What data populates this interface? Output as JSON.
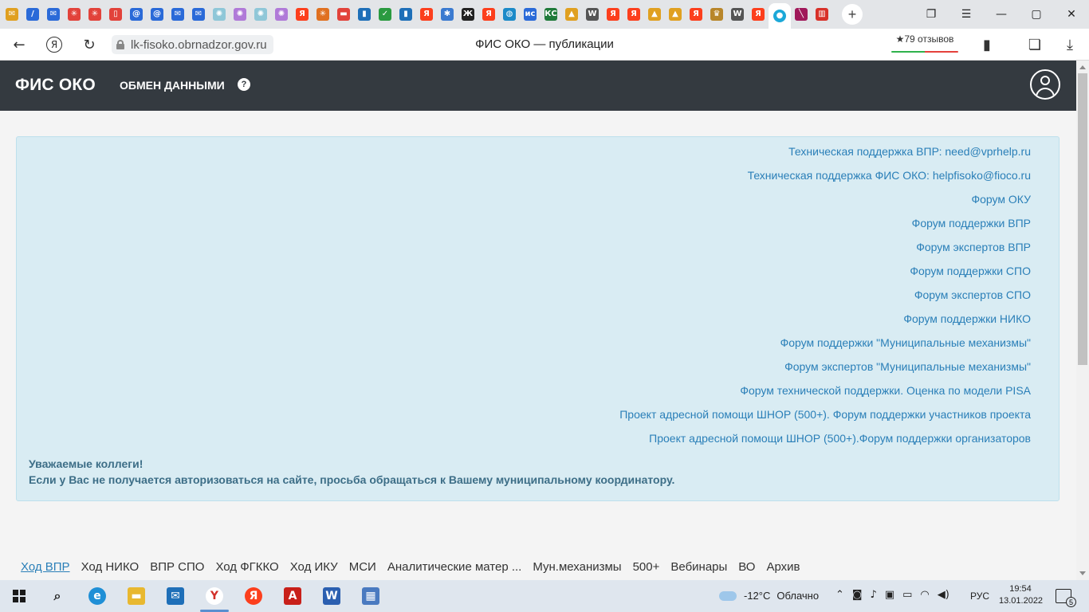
{
  "browser": {
    "tabs": [
      {
        "name": "tab-mail",
        "color": "#e0a020",
        "glyph": "✉"
      },
      {
        "name": "tab-edit",
        "color": "#2a6ad8",
        "glyph": "/"
      },
      {
        "name": "tab-mail2",
        "color": "#2a6ad8",
        "glyph": "✉"
      },
      {
        "name": "tab-wheel1",
        "color": "#e2423a",
        "glyph": "✳"
      },
      {
        "name": "tab-wheel2",
        "color": "#e2423a",
        "glyph": "✳"
      },
      {
        "name": "tab-pdf",
        "color": "#e2423a",
        "glyph": "▯"
      },
      {
        "name": "tab-at1",
        "color": "#2a6ad8",
        "glyph": "@"
      },
      {
        "name": "tab-at2",
        "color": "#2a6ad8",
        "glyph": "@"
      },
      {
        "name": "tab-mail3",
        "color": "#2a6ad8",
        "glyph": "✉"
      },
      {
        "name": "tab-mail4",
        "color": "#2a6ad8",
        "glyph": "✉"
      },
      {
        "name": "tab-dots1",
        "color": "#8fc7d8",
        "glyph": "✺"
      },
      {
        "name": "tab-dots2",
        "color": "#b07ad8",
        "glyph": "✺"
      },
      {
        "name": "tab-dots3",
        "color": "#8fc7d8",
        "glyph": "✺"
      },
      {
        "name": "tab-dots4",
        "color": "#b07ad8",
        "glyph": "✺"
      },
      {
        "name": "tab-yandex1",
        "color": "#fc3f1d",
        "glyph": "Я"
      },
      {
        "name": "tab-wheel3",
        "color": "#e07020",
        "glyph": "✳"
      },
      {
        "name": "tab-box",
        "color": "#e2423a",
        "glyph": "▬"
      },
      {
        "name": "tab-book1",
        "color": "#1e6fb8",
        "glyph": "▮"
      },
      {
        "name": "tab-check",
        "color": "#2a9a40",
        "glyph": "✓"
      },
      {
        "name": "tab-book2",
        "color": "#1e6fb8",
        "glyph": "▮"
      },
      {
        "name": "tab-yandex2",
        "color": "#fc3f1d",
        "glyph": "Я"
      },
      {
        "name": "tab-star",
        "color": "#3a7ad0",
        "glyph": "✱"
      },
      {
        "name": "tab-zh",
        "color": "#222222",
        "glyph": "Ж"
      },
      {
        "name": "tab-yandex3",
        "color": "#fc3f1d",
        "glyph": "Я"
      },
      {
        "name": "tab-globe",
        "color": "#1c8ac8",
        "glyph": "◍"
      },
      {
        "name": "tab-mos",
        "color": "#2a6ad8",
        "glyph": "ис"
      },
      {
        "name": "tab-kc",
        "color": "#1f7a3a",
        "glyph": "КС"
      },
      {
        "name": "tab-hat1",
        "color": "#e0a020",
        "glyph": "▲"
      },
      {
        "name": "tab-wiki1",
        "color": "#555555",
        "glyph": "W"
      },
      {
        "name": "tab-yandex4",
        "color": "#fc3f1d",
        "glyph": "Я"
      },
      {
        "name": "tab-yandex5",
        "color": "#fc3f1d",
        "glyph": "Я"
      },
      {
        "name": "tab-hat2",
        "color": "#e0a020",
        "glyph": "▲"
      },
      {
        "name": "tab-hat3",
        "color": "#e0a020",
        "glyph": "▲"
      },
      {
        "name": "tab-yandex6",
        "color": "#fc3f1d",
        "glyph": "Я"
      },
      {
        "name": "tab-emblem",
        "color": "#b8862a",
        "glyph": "♛"
      },
      {
        "name": "tab-wiki2",
        "color": "#555555",
        "glyph": "W"
      },
      {
        "name": "tab-yandex7",
        "color": "#fc3f1d",
        "glyph": "Я"
      },
      {
        "name": "tab-fisoko-active",
        "color": "#1ca8d8",
        "glyph": "●"
      },
      {
        "name": "tab-feather",
        "color": "#a0185a",
        "glyph": "╲"
      },
      {
        "name": "tab-bars",
        "color": "#d8322a",
        "glyph": "▥"
      }
    ],
    "url": "lk-fisoko.obrnadzor.gov.ru",
    "page_title": "ФИС ОКО — публикации",
    "reviews": "★79 отзывов"
  },
  "site": {
    "logo": "ФИС ОКО",
    "nav_exchange": "ОБМЕН ДАННЫМИ",
    "help_glyph": "?"
  },
  "links": [
    "Техническая поддержка ВПР: need@vprhelp.ru",
    "Техническая поддержка ФИС ОКО: helpfisoko@fioco.ru",
    "Форум ОКУ",
    "Форум поддержки ВПР",
    "Форум экспертов ВПР",
    "Форум поддержки СПО",
    "Форум экспертов СПО",
    "Форум поддержки НИКО",
    "Форум поддержки \"Муниципальные механизмы\"",
    "Форум экспертов \"Муниципальные механизмы\"",
    "Форум технической поддержки. Оценка по модели PISA",
    "Проект адресной помощи ШНОР (500+). Форум поддержки участников проекта",
    "Проект адресной помощи ШНОР (500+).Форум поддержки организаторов"
  ],
  "notice": {
    "line1": "Уважаемые коллеги!",
    "line2": "Если у Вас не получается авторизоваться на сайте, просьба обращаться к Вашему муниципальному координатору."
  },
  "bottom_nav": [
    "Ход ВПР",
    "Ход НИКО",
    "ВПР СПО",
    "Ход ФГККО",
    "Ход ИКУ",
    "МСИ",
    "Аналитические матер ...",
    "Мун.механизмы",
    "500+",
    "Вебинары",
    "ВО",
    "Архив"
  ],
  "taskbar": {
    "weather_temp": "-12°C",
    "weather_text": "Облачно",
    "lang": "РУС",
    "time": "19:54",
    "date": "13.01.2022",
    "notifications": "5"
  }
}
